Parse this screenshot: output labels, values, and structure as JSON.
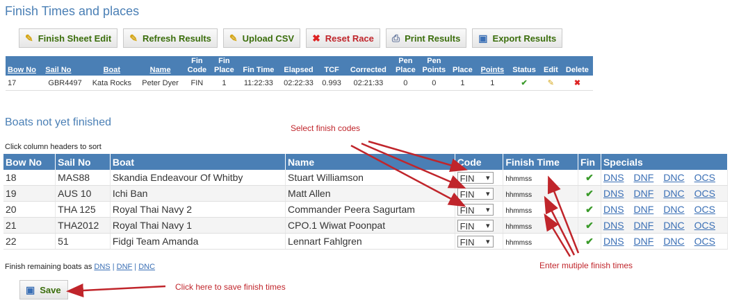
{
  "page": {
    "title": "Finish Times and places",
    "not_finished_title": "Boats not yet finished",
    "sort_hint": "Click column headers to sort",
    "remaining_prefix": "Finish remaining boats as",
    "remaining_links": [
      "DNS",
      "DNF",
      "DNC"
    ],
    "remaining_seps": [
      "|",
      "|"
    ]
  },
  "toolbar": {
    "finish_sheet": "Finish Sheet Edit",
    "refresh": "Refresh Results",
    "upload": "Upload CSV",
    "reset": "Reset Race",
    "print": "Print Results",
    "export": "Export Results"
  },
  "results": {
    "headers": [
      "Bow No",
      "Sail No",
      "Boat",
      "Name",
      "Fin Code",
      "Fin Place",
      "Fin Time",
      "Elapsed",
      "TCF",
      "Corrected",
      "Pen Place",
      "Pen Points",
      "Place",
      "Points",
      "Status",
      "Edit",
      "Delete"
    ],
    "row": [
      "17",
      "GBR4497",
      "Kata Rocks",
      "Peter Dyer",
      "FIN",
      "1",
      "11:22:33",
      "02:22:33",
      "0.993",
      "02:21:33",
      "0",
      "0",
      "1",
      "1"
    ]
  },
  "boats": {
    "headers": [
      "Bow No",
      "Sail No",
      "Boat",
      "Name",
      "Code",
      "Finish Time",
      "Fin",
      "Specials"
    ],
    "specials": [
      "DNS",
      "DNF",
      "DNC",
      "OCS"
    ],
    "code_value": "FIN",
    "time_placeholder": "hhmmss",
    "rows": [
      [
        "18",
        "MAS88",
        "Skandia Endeavour Of Whitby",
        "Stuart Williamson"
      ],
      [
        "19",
        "AUS 10",
        "Ichi Ban",
        "Matt Allen"
      ],
      [
        "20",
        "THA 125",
        "Royal Thai Navy 2",
        "Commander Peera Sagurtam"
      ],
      [
        "21",
        "THA2012",
        "Royal Thai Navy 1",
        "CPO.1 Wiwat Poonpat"
      ],
      [
        "22",
        "51",
        "Fidgi Team Amanda",
        "Lennart Fahlgren"
      ]
    ]
  },
  "save": {
    "label": "Save"
  },
  "annotations": {
    "select_codes": "Select finish codes",
    "multiple_times": "Enter mutiple finish times",
    "save_hint": "Click here to save finish times"
  },
  "colors": {
    "header": "#4a7fb5",
    "annotation": "#c0252b"
  }
}
